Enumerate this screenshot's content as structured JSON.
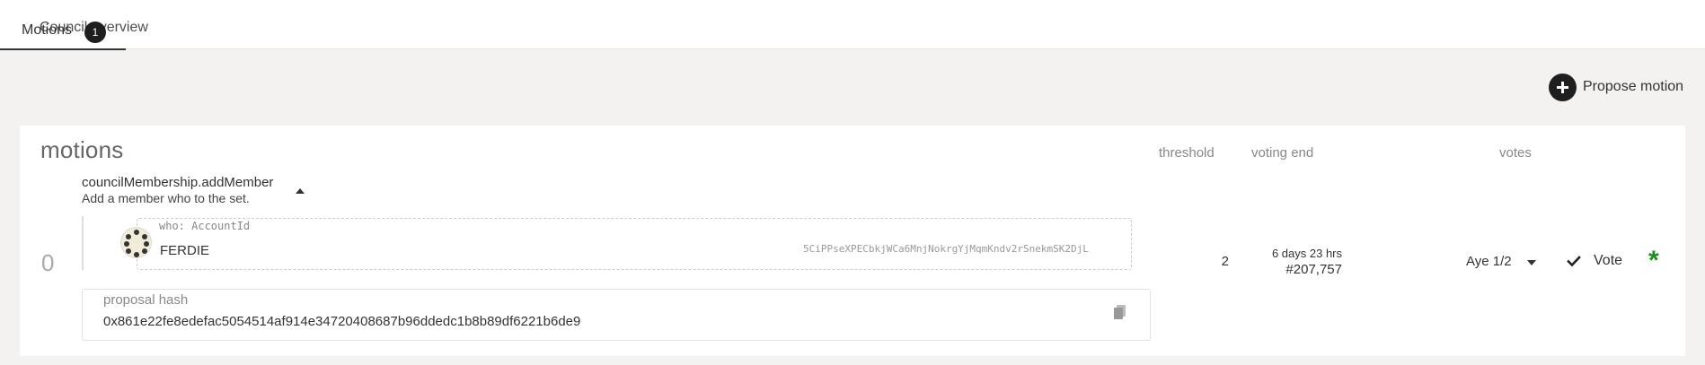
{
  "tabs": [
    {
      "label": "Council overview"
    },
    {
      "label": "Motions",
      "badge": "1"
    }
  ],
  "actions": {
    "propose_label": "Propose motion"
  },
  "motions": {
    "title": "motions",
    "columns": {
      "threshold": "threshold",
      "voting_end": "voting end",
      "votes": "votes"
    },
    "items": [
      {
        "index": "0",
        "method": "councilMembership.addMember",
        "description": "Add a member who to the set.",
        "param_label": "who: AccountId",
        "account_name": "FERDIE",
        "account_address": "5CiPPseXPECbkjWCa6MnjNokrgYjMqmKndv2rSnekmSK2DjL",
        "proposal_hash_label": "proposal hash",
        "proposal_hash": "0x861e22fe8edefac5054514af914e34720408687b96ddedc1b8b89df6221b6de9",
        "threshold": "2",
        "voting_end_time": "6 days 23 hrs",
        "voting_end_block": "#207,757",
        "votes_summary": "Aye 1/2",
        "vote_label": "Vote",
        "marker": "*"
      }
    ]
  },
  "colors": {
    "accent_dark": "#1f1f1f",
    "success": "#1a8f1a",
    "background": "#f3f2f0"
  },
  "icons": [
    "plus-icon",
    "chevron-up-icon",
    "identicon",
    "copy-icon",
    "chevron-down-icon",
    "check-icon",
    "asterisk-icon"
  ]
}
